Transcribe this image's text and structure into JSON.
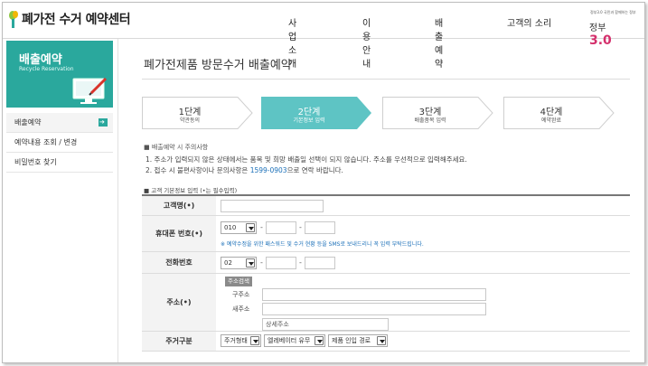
{
  "header": {
    "site_title": "폐가전 수거 예약센터",
    "nav": [
      "사업소개",
      "이용안내",
      "배출예약",
      "고객의 소리"
    ],
    "gov_small": "정부3.0 국민과 함께하는 정부",
    "gov_text": "정부",
    "gov_num": "3.0"
  },
  "sidebar": {
    "banner_title": "배출예약",
    "banner_sub": "Recycle Reservation",
    "items": [
      {
        "label": "배출예약"
      },
      {
        "label": "예약내용 조회 / 변경"
      },
      {
        "label": "비밀번호 찾기"
      }
    ]
  },
  "main": {
    "page_title": "폐가전제품 방문수거 배출예약",
    "steps": [
      {
        "title": "1단계",
        "sub": "약관동의"
      },
      {
        "title": "2단계",
        "sub": "기본정보 입력"
      },
      {
        "title": "3단계",
        "sub": "배출품목 입력"
      },
      {
        "title": "4단계",
        "sub": "예약완료"
      }
    ],
    "notice_heading": "■ 배출예약 시 주의사항",
    "notice_1": "1. 주소가 입력되지 않은 상태에서는 품목 및 희망 배출일 선택이 되지 않습니다. 주소를 우선적으로 입력해주세요.",
    "notice_2_pre": "2. 접수 시 불편사항이나 문의사항은 ",
    "notice_2_tel": "1599-0903",
    "notice_2_post": "으로 연락 바랍니다.",
    "form_heading": "■ 고객 기본정보 입력 (•는 필수입력)"
  },
  "form": {
    "name_label": "고객명(•)",
    "mobile_label": "휴대폰 번호(•)",
    "mobile_prefix": "010",
    "mobile_hint": "※ 예약수정을 위한 패스워드 및 수거 현황 등을 SMS로 보내드리니 꼭 입력 부탁드립니다.",
    "phone_label": "전화번호",
    "phone_prefix": "02",
    "dash": "-",
    "address_label": "주소(•)",
    "address_search": "주소검색",
    "old_address": "구주소",
    "new_address": "새주소",
    "detail_placeholder": "상세주소",
    "housing_label": "주거구분",
    "housing_select": "주거형태",
    "elevator_select": "엘레베이터 유무",
    "path_select": "제품 인입 경로"
  },
  "colors": {
    "accent": "#2aa89d",
    "link": "#1a6fb8"
  }
}
